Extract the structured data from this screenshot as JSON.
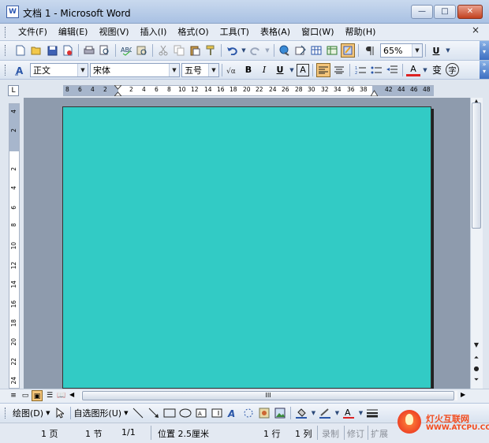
{
  "window": {
    "title": "文档 1 - Microsoft Word",
    "app_icon": "W",
    "min": "—",
    "max": "□",
    "close": "✕"
  },
  "menu": {
    "items": [
      "文件(F)",
      "编辑(E)",
      "视图(V)",
      "插入(I)",
      "格式(O)",
      "工具(T)",
      "表格(A)",
      "窗口(W)",
      "帮助(H)"
    ],
    "close_doc": "×"
  },
  "standard_toolbar": {
    "zoom": "65%",
    "underline_label": "U"
  },
  "formatting_toolbar": {
    "style": "正文",
    "font": "宋体",
    "size": "五号",
    "bold": "B",
    "italic": "I",
    "underline": "U",
    "charborder": "A",
    "fontcolor": "A",
    "phonetic": "变",
    "enclose": "字"
  },
  "ruler": {
    "corner": "L",
    "h_left_ticks": [
      "8",
      "6",
      "4",
      "2"
    ],
    "h_ticks": [
      "2",
      "4",
      "6",
      "8",
      "10",
      "12",
      "14",
      "16",
      "18",
      "20",
      "22",
      "24",
      "26",
      "28",
      "30",
      "32",
      "34",
      "36",
      "38"
    ],
    "h_right_ticks": [
      "42",
      "44",
      "46",
      "48"
    ],
    "v_top_ticks": [
      "4",
      "2"
    ],
    "v_ticks": [
      "2",
      "4",
      "6",
      "8",
      "10",
      "12",
      "14",
      "16",
      "18",
      "20",
      "22",
      "24"
    ]
  },
  "scroll": {
    "hthumb_grip": "III"
  },
  "drawing_toolbar": {
    "draw": "绘图(D)",
    "autoshapes": "自选图形(U)"
  },
  "statusbar": {
    "page": "1 页",
    "section": "1 节",
    "pages": "1/1",
    "position": "位置 2.5厘米",
    "line": "1 行",
    "col": "1 列",
    "rec": "录制",
    "trk": "修订",
    "ext": "扩展"
  },
  "watermark": {
    "cn": "灯火互联网",
    "url": "WWW.ATCPU.COM"
  },
  "colors": {
    "page": "#32cbc5",
    "workspace": "#8e9bad"
  }
}
